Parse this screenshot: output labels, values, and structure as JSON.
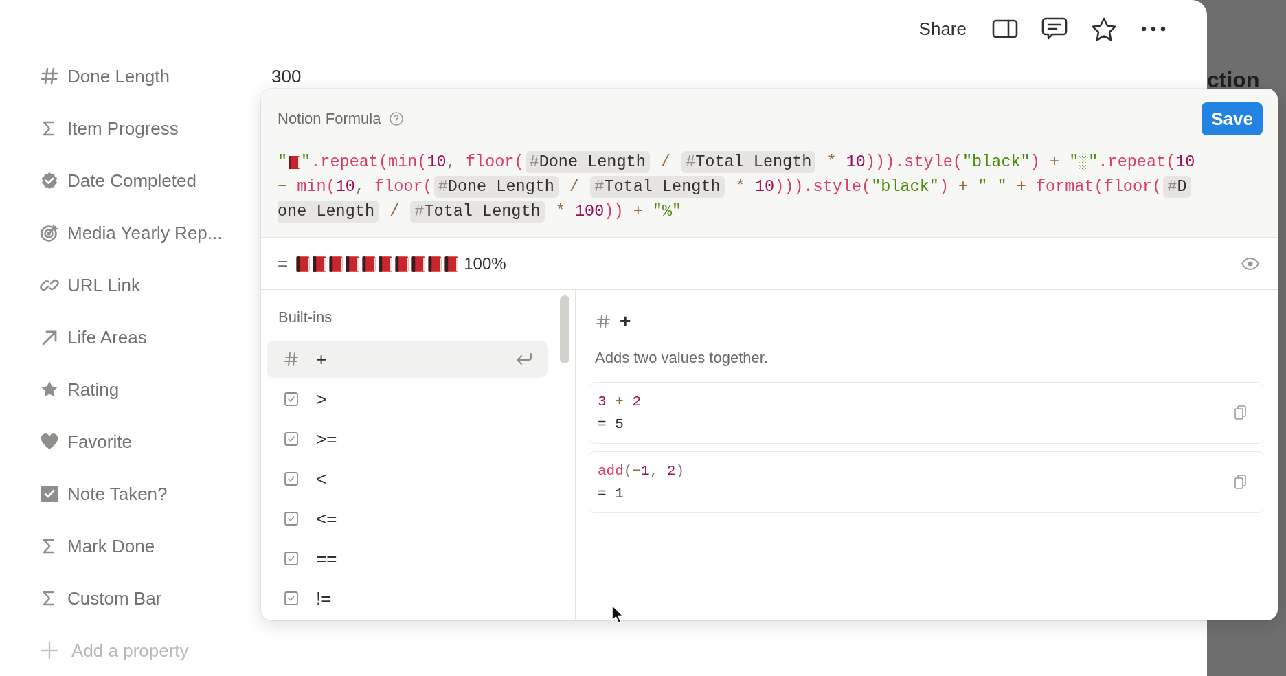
{
  "topbar": {
    "share": "Share"
  },
  "properties": [
    {
      "kind": "number",
      "name": "Done Length",
      "value": "300"
    },
    {
      "kind": "formula",
      "name": "Item Progress"
    },
    {
      "kind": "badge",
      "name": "Date Completed"
    },
    {
      "kind": "target",
      "name": "Media Yearly Rep..."
    },
    {
      "kind": "link",
      "name": "URL Link"
    },
    {
      "kind": "relation",
      "name": "Life Areas"
    },
    {
      "kind": "star",
      "name": "Rating"
    },
    {
      "kind": "heart",
      "name": "Favorite"
    },
    {
      "kind": "checkbox",
      "name": "Note Taken?"
    },
    {
      "kind": "formula",
      "name": "Mark Done"
    },
    {
      "kind": "formula",
      "name": "Custom Bar"
    }
  ],
  "add_property": "Add a property",
  "background_heading": "ction",
  "formula": {
    "title": "Notion Formula",
    "save": "Save",
    "lines": [
      [
        {
          "kind": "str",
          "text": "\""
        },
        {
          "kind": "book"
        },
        {
          "kind": "str",
          "text": "\""
        },
        {
          "kind": "func",
          "text": ".repeat(min("
        },
        {
          "kind": "num",
          "text": "10"
        },
        {
          "kind": "plain",
          "text": ", "
        },
        {
          "kind": "func",
          "text": "floor("
        },
        {
          "kind": "prop",
          "icon": "#",
          "text": "Done Length"
        },
        {
          "kind": "op",
          "text": " / "
        },
        {
          "kind": "prop",
          "icon": "#",
          "text": "Total Length"
        },
        {
          "kind": "op",
          "text": " * "
        },
        {
          "kind": "num",
          "text": "10"
        },
        {
          "kind": "func",
          "text": "))).style("
        },
        {
          "kind": "str",
          "text": "\"black\""
        },
        {
          "kind": "func",
          "text": ")"
        },
        {
          "kind": "op",
          "text": " + "
        },
        {
          "kind": "str",
          "text": "\"░\""
        },
        {
          "kind": "func",
          "text": ".repeat("
        },
        {
          "kind": "num",
          "text": "10"
        }
      ],
      [
        {
          "kind": "op",
          "text": "− "
        },
        {
          "kind": "func",
          "text": "min("
        },
        {
          "kind": "num",
          "text": "10"
        },
        {
          "kind": "plain",
          "text": ", "
        },
        {
          "kind": "func",
          "text": "floor("
        },
        {
          "kind": "prop",
          "icon": "#",
          "text": "Done Length"
        },
        {
          "kind": "op",
          "text": " / "
        },
        {
          "kind": "prop",
          "icon": "#",
          "text": "Total Length"
        },
        {
          "kind": "op",
          "text": " * "
        },
        {
          "kind": "num",
          "text": "10"
        },
        {
          "kind": "func",
          "text": "))).style("
        },
        {
          "kind": "str",
          "text": "\"black\""
        },
        {
          "kind": "func",
          "text": ")"
        },
        {
          "kind": "op",
          "text": " + "
        },
        {
          "kind": "str",
          "text": "\" \""
        },
        {
          "kind": "op",
          "text": " + "
        },
        {
          "kind": "func",
          "text": "format(floor("
        },
        {
          "kind": "prop",
          "icon": "#",
          "text": "D"
        }
      ],
      [
        {
          "kind": "prop",
          "text": "one Length"
        },
        {
          "kind": "op",
          "text": " / "
        },
        {
          "kind": "prop",
          "icon": "#",
          "text": "Total Length"
        },
        {
          "kind": "op",
          "text": " * "
        },
        {
          "kind": "num",
          "text": "100"
        },
        {
          "kind": "func",
          "text": "))"
        },
        {
          "kind": "op",
          "text": " + "
        },
        {
          "kind": "str",
          "text": "\"%\""
        }
      ]
    ],
    "result": {
      "equals": "=",
      "blocks": [
        {
          "kind": "book"
        },
        {
          "kind": "book"
        },
        {
          "kind": "book"
        },
        {
          "kind": "book"
        },
        {
          "kind": "book"
        },
        {
          "kind": "book"
        },
        {
          "kind": "book"
        },
        {
          "kind": "book"
        },
        {
          "kind": "book"
        },
        {
          "kind": "book"
        }
      ],
      "text": "100%"
    },
    "section": "Built-ins",
    "items": [
      {
        "kind": "number",
        "label": "+",
        "selected": true
      },
      {
        "kind": "checkbox",
        "label": ">",
        "selected": false
      },
      {
        "kind": "checkbox",
        "label": ">=",
        "selected": false
      },
      {
        "kind": "checkbox",
        "label": "<",
        "selected": false
      },
      {
        "kind": "checkbox",
        "label": "<=",
        "selected": false
      },
      {
        "kind": "checkbox",
        "label": "==",
        "selected": false
      },
      {
        "kind": "checkbox",
        "label": "!=",
        "selected": false
      }
    ],
    "detail": {
      "kind": "number",
      "name": "+",
      "description": "Adds two values together.",
      "examples": [
        {
          "code": [
            {
              "kind": "num",
              "text": "3"
            },
            {
              "kind": "op",
              "text": " + "
            },
            {
              "kind": "num",
              "text": "2"
            }
          ],
          "result": "= 5"
        },
        {
          "code": [
            {
              "kind": "func",
              "text": "add"
            },
            {
              "kind": "plain",
              "text": "("
            },
            {
              "kind": "op",
              "text": "−"
            },
            {
              "kind": "num",
              "text": "1"
            },
            {
              "kind": "plain",
              "text": ", "
            },
            {
              "kind": "num",
              "text": "2"
            },
            {
              "kind": "plain",
              "text": ")"
            }
          ],
          "result": "= 1"
        }
      ]
    }
  }
}
